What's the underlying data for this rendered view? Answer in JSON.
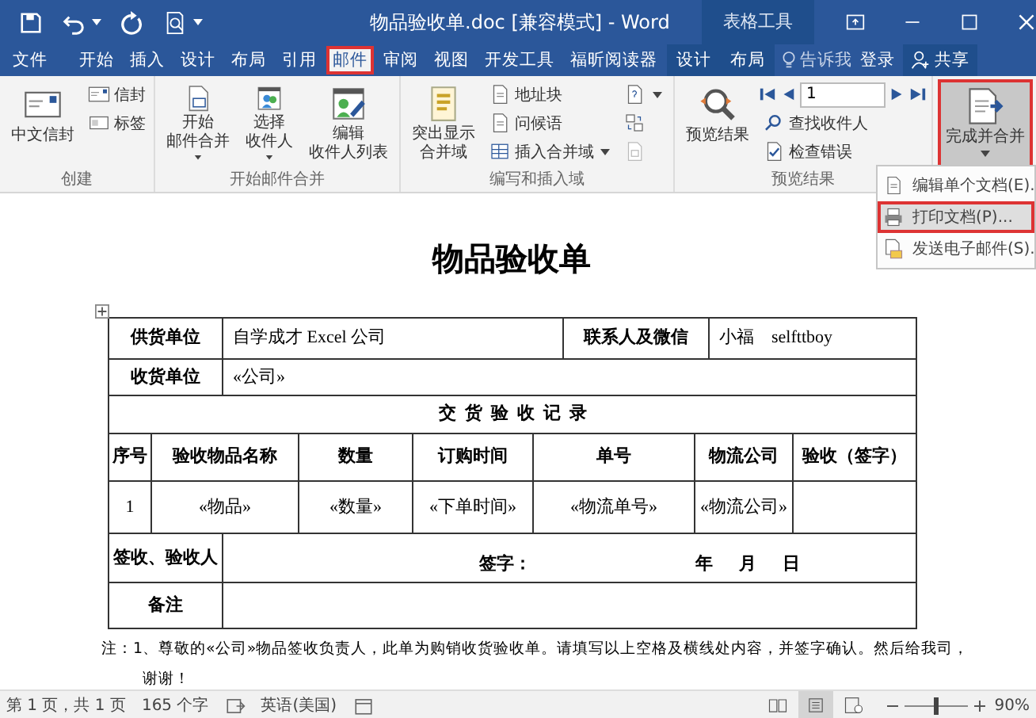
{
  "title_bar": {
    "title": "物品验收单.doc [兼容模式] - Word",
    "context_tab": "表格工具"
  },
  "ribbon_tabs": [
    {
      "label": "文件",
      "selected": false,
      "context": false
    },
    {
      "label": "开始",
      "selected": false,
      "context": false
    },
    {
      "label": "插入",
      "selected": false,
      "context": false
    },
    {
      "label": "设计",
      "selected": false,
      "context": false
    },
    {
      "label": "布局",
      "selected": false,
      "context": false
    },
    {
      "label": "引用",
      "selected": false,
      "context": false
    },
    {
      "label": "邮件",
      "selected": true,
      "context": false
    },
    {
      "label": "审阅",
      "selected": false,
      "context": false
    },
    {
      "label": "视图",
      "selected": false,
      "context": false
    },
    {
      "label": "开发工具",
      "selected": false,
      "context": false
    },
    {
      "label": "福昕阅读器",
      "selected": false,
      "context": false
    },
    {
      "label": "设计",
      "selected": false,
      "context": true
    },
    {
      "label": "布局",
      "selected": false,
      "context": true
    }
  ],
  "tell_me": "告诉我",
  "sign_in": "登录",
  "share": "共享",
  "ribbon_groups": [
    {
      "label": "创建",
      "columns": [
        {
          "kind": "large",
          "lines": [
            "中文信封"
          ],
          "dropdown": false,
          "pressed": false
        },
        {
          "kind": "stack",
          "items": [
            {
              "kind": "button",
              "label": "信封",
              "dropdown": false
            },
            {
              "kind": "button",
              "label": "标签",
              "dropdown": false
            }
          ]
        }
      ]
    },
    {
      "label": "开始邮件合并",
      "columns": [
        {
          "kind": "large",
          "lines": [
            "开始",
            "邮件合并"
          ],
          "dropdown": true,
          "pressed": false
        },
        {
          "kind": "large",
          "lines": [
            "选择",
            "收件人"
          ],
          "dropdown": true,
          "pressed": false
        },
        {
          "kind": "large",
          "lines": [
            "编辑",
            "收件人列表"
          ],
          "dropdown": false,
          "pressed": false
        }
      ]
    },
    {
      "label": "编写和插入域",
      "columns": [
        {
          "kind": "large",
          "lines": [
            "突出显示",
            "合并域"
          ],
          "dropdown": false,
          "pressed": false
        },
        {
          "kind": "stack",
          "items": [
            {
              "kind": "button",
              "label": "地址块",
              "dropdown": false
            },
            {
              "kind": "button",
              "label": "问候语",
              "dropdown": false
            },
            {
              "kind": "button",
              "label": "插入合并域",
              "dropdown": true
            }
          ]
        },
        {
          "kind": "stack",
          "items": [
            {
              "kind": "button",
              "dropdown": true
            },
            {
              "kind": "button",
              "dropdown": false
            },
            {
              "kind": "button",
              "dropdown": false
            }
          ]
        }
      ]
    },
    {
      "label": "预览结果",
      "columns": [
        {
          "kind": "large",
          "lines": [
            "预览结果"
          ],
          "dropdown": false,
          "pressed": false
        },
        {
          "kind": "stack",
          "items": [
            {
              "kind": "nav",
              "value": "1"
            },
            {
              "kind": "button",
              "label": "查找收件人",
              "dropdown": false
            },
            {
              "kind": "button",
              "label": "检查错误",
              "dropdown": false
            }
          ]
        }
      ]
    },
    {
      "columns": [
        {
          "kind": "large",
          "lines": [
            "完成并合并"
          ],
          "dropdown": true,
          "pressed": true
        }
      ]
    }
  ],
  "finish_menu": [
    {
      "label": "编辑单个文档(E).",
      "selected": false
    },
    {
      "label": "打印文档(P)...",
      "selected": true
    },
    {
      "label": "发送电子邮件(S).",
      "selected": false
    }
  ],
  "document": {
    "title": "物品验收单",
    "field_rows": [
      [
        {
          "label": "供货单位",
          "value": "自学成才 Excel 公司"
        },
        {
          "label": "联系人及微信",
          "value": "小福    selfttboy"
        }
      ],
      [
        {
          "label": "收货单位",
          "value": "«公司»"
        }
      ]
    ],
    "records": {
      "title": "交  货  验  收  记  录",
      "columns": [
        "序号",
        "验收物品名称",
        "数量",
        "订购时间",
        "单号",
        "物流公司",
        "验收（签字）"
      ],
      "rows": [
        [
          "1",
          "«物品»",
          "«数量»",
          "«下单时间»",
          "«物流单号»",
          "«物流公司»",
          ""
        ]
      ]
    },
    "sign_row": {
      "label": "签收、验收人",
      "sign_label": "签字：",
      "date_label": "年      月      日"
    },
    "remarks": {
      "label": "备注"
    },
    "notes": [
      "注：1、尊敬的«公司»物品签收负责人，此单为购销收货验收单。请填写以上空格及横线处内容，并签字确认。然后给我司，",
      "谢谢！"
    ]
  },
  "status_bar": {
    "page": "第 1 页，共 1 页",
    "words": "165 个字",
    "language": "英语(美国)",
    "views": [
      {
        "selected": false
      },
      {
        "selected": true
      },
      {
        "selected": false
      }
    ],
    "zoom": {
      "level": 0.5,
      "text": "90%"
    }
  }
}
